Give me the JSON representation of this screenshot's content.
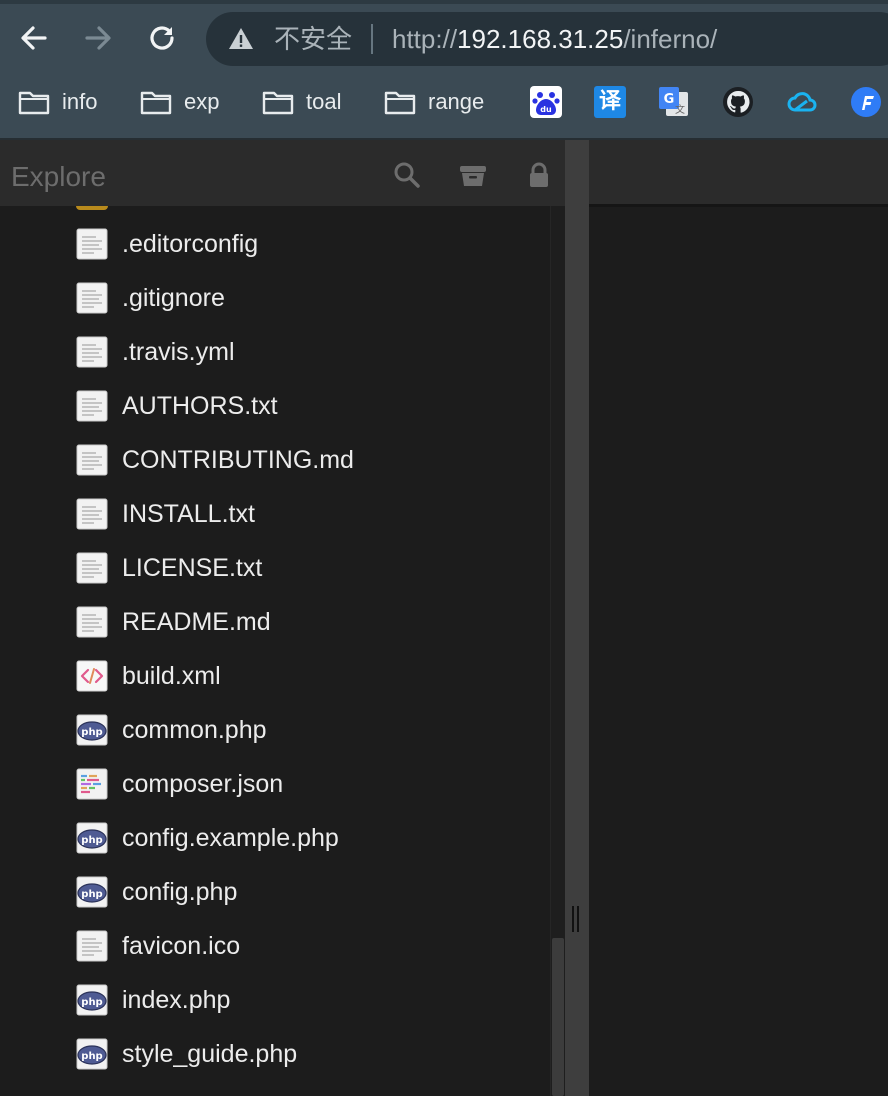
{
  "browser": {
    "back_icon": "arrow-left-icon",
    "forward_icon": "arrow-right-icon",
    "reload_icon": "reload-icon",
    "security_label": "不安全",
    "url_scheme": "http://",
    "url_host": "192.168.31.25",
    "url_path": "/inferno/",
    "bookmarks": [
      {
        "label": "info",
        "icon": "folder-icon"
      },
      {
        "label": "exp",
        "icon": "folder-icon"
      },
      {
        "label": "toal",
        "icon": "folder-icon"
      },
      {
        "label": "range",
        "icon": "folder-icon"
      }
    ],
    "bookmark_icons": [
      "baidu-icon",
      "translate-icon",
      "google-translate-icon",
      "github-icon",
      "cloud-icon",
      "flash-icon"
    ],
    "translate_glyph": "译",
    "baidu_glyph": "du"
  },
  "explorer": {
    "title": "Explore",
    "header_icons": [
      "search-icon",
      "archive-icon",
      "lock-icon"
    ],
    "files": [
      {
        "name": ".editorconfig",
        "type": "text"
      },
      {
        "name": ".gitignore",
        "type": "text"
      },
      {
        "name": ".travis.yml",
        "type": "text"
      },
      {
        "name": "AUTHORS.txt",
        "type": "text"
      },
      {
        "name": "CONTRIBUTING.md",
        "type": "text"
      },
      {
        "name": "INSTALL.txt",
        "type": "text"
      },
      {
        "name": "LICENSE.txt",
        "type": "text"
      },
      {
        "name": "README.md",
        "type": "text"
      },
      {
        "name": "build.xml",
        "type": "xml"
      },
      {
        "name": "common.php",
        "type": "php"
      },
      {
        "name": "composer.json",
        "type": "json"
      },
      {
        "name": "config.example.php",
        "type": "php"
      },
      {
        "name": "config.php",
        "type": "php"
      },
      {
        "name": "favicon.ico",
        "type": "text"
      },
      {
        "name": "index.php",
        "type": "php"
      },
      {
        "name": "style_guide.php",
        "type": "php"
      }
    ]
  },
  "colors": {
    "chrome_bg": "#3b4a54",
    "omnibox_bg": "#26323a",
    "sidebar_bg": "#1c1c1c",
    "header_bg": "#2b2b2b",
    "php_badge": "#4f5b93"
  }
}
